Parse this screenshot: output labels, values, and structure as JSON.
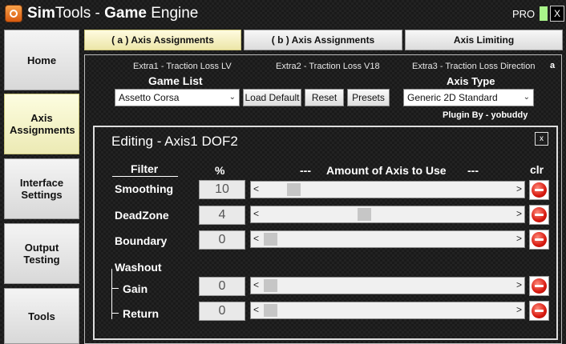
{
  "window": {
    "title_part1": "Sim",
    "title_part2": "Tools - ",
    "title_part3": "Game",
    "title_part4": " Engine",
    "pro_label": "PRO",
    "close_glyph": "X",
    "pro_indicator_color": "#a9f58a"
  },
  "sidebar": {
    "items": [
      {
        "label": "Home"
      },
      {
        "label": "Axis Assignments",
        "active": true
      },
      {
        "label": "Interface Settings"
      },
      {
        "label": "Output Testing"
      },
      {
        "label": "Tools"
      }
    ]
  },
  "tabs": [
    {
      "label": "( a ) Axis Assignments",
      "active": true
    },
    {
      "label": "( b ) Axis Assignments"
    },
    {
      "label": "Axis Limiting"
    }
  ],
  "extras": {
    "extra1": "Extra1 - Traction Loss LV",
    "extra2": "Extra2 - Traction Loss V18",
    "extra3": "Extra3 - Traction Loss Direction",
    "marker": "a"
  },
  "game_list": {
    "heading": "Game List",
    "selected": "Assetto Corsa",
    "buttons": {
      "load_default": "Load Default",
      "reset": "Reset",
      "presets": "Presets"
    }
  },
  "axis_type": {
    "heading": "Axis Type",
    "selected": "Generic 2D Standard",
    "plugin_by": "Plugin By - yobuddy"
  },
  "editor": {
    "title": "Editing - Axis1 DOF2",
    "close_glyph": "x",
    "headers": {
      "filter": "Filter",
      "percent": "%",
      "dashes_left": "---",
      "amount": "Amount of Axis to Use",
      "dashes_right": "---",
      "clr": "clr"
    },
    "washout_label": "Washout",
    "rows": [
      {
        "label": "Smoothing",
        "value": "10",
        "slider_fraction": 0.1
      },
      {
        "label": "DeadZone",
        "value": "4",
        "slider_fraction": 0.4
      },
      {
        "label": "Boundary",
        "value": "0",
        "slider_fraction": 0.0
      },
      {
        "label": "Gain",
        "value": "0",
        "slider_fraction": 0.0
      },
      {
        "label": "Return",
        "value": "0",
        "slider_fraction": 0.0
      }
    ]
  }
}
